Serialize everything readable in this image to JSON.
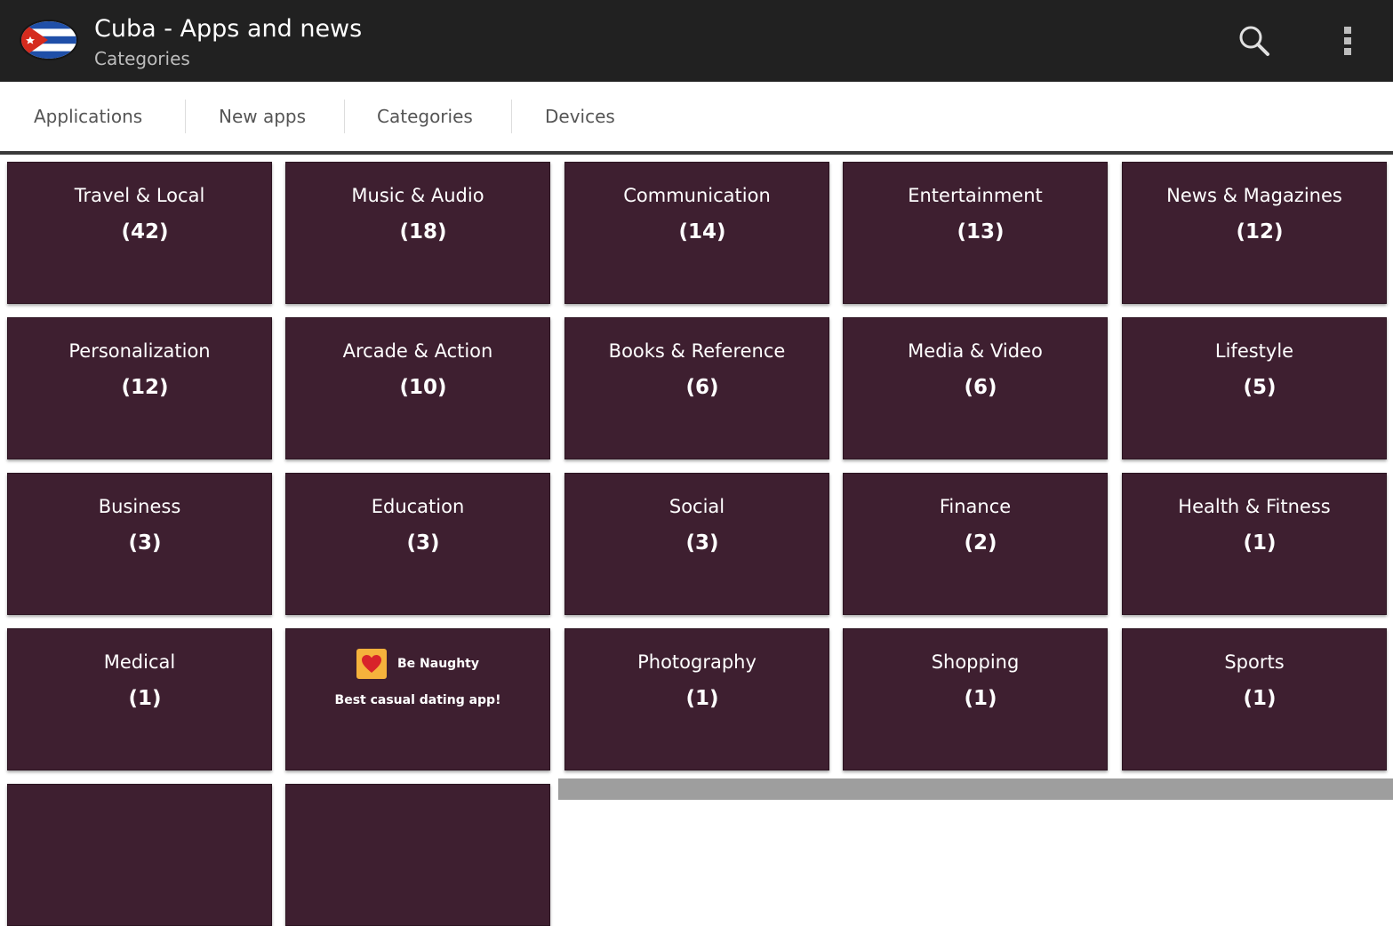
{
  "action_bar": {
    "title": "Cuba - Apps and news",
    "subtitle": "Categories",
    "flag_icon": "cuba-flag-icon",
    "search_icon": "search-icon",
    "overflow_icon": "more-vert-icon"
  },
  "tabs": [
    {
      "label": "Applications"
    },
    {
      "label": "New apps"
    },
    {
      "label": "Categories"
    },
    {
      "label": "Devices"
    }
  ],
  "categories": [
    {
      "name": "Travel & Local",
      "count": "(42)"
    },
    {
      "name": "Music & Audio",
      "count": "(18)"
    },
    {
      "name": "Communication",
      "count": "(14)"
    },
    {
      "name": "Entertainment",
      "count": "(13)"
    },
    {
      "name": "News & Magazines",
      "count": "(12)"
    },
    {
      "name": "Personalization",
      "count": "(12)"
    },
    {
      "name": "Arcade & Action",
      "count": "(10)"
    },
    {
      "name": "Books & Reference",
      "count": "(6)"
    },
    {
      "name": "Media & Video",
      "count": "(6)"
    },
    {
      "name": "Lifestyle",
      "count": "(5)"
    },
    {
      "name": "Business",
      "count": "(3)"
    },
    {
      "name": "Education",
      "count": "(3)"
    },
    {
      "name": "Social",
      "count": "(3)"
    },
    {
      "name": "Finance",
      "count": "(2)"
    },
    {
      "name": "Health & Fitness",
      "count": "(1)"
    },
    {
      "name": "Medical",
      "count": "(1)"
    },
    {
      "name": "Photography",
      "count": "(1)"
    },
    {
      "name": "Shopping",
      "count": "(1)"
    },
    {
      "name": "Sports",
      "count": "(1)"
    }
  ],
  "ad": {
    "brand": "Be Naughty",
    "tagline": "Best casual dating app!",
    "logo_icon": "heart-icon"
  },
  "colors": {
    "action_bar": "#212121",
    "tile": "#3e1f30",
    "tab_text": "#555555"
  }
}
